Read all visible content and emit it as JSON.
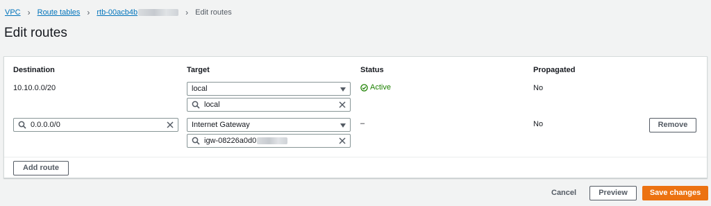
{
  "breadcrumb": {
    "items": [
      "VPC",
      "Route tables",
      "rtb-00acb4b"
    ],
    "current": "Edit routes"
  },
  "page_title": "Edit routes",
  "table": {
    "headers": [
      "Destination",
      "Target",
      "Status",
      "Propagated"
    ],
    "rows": [
      {
        "destination": "10.10.0.0/20",
        "target_type": "local",
        "target_value": "local",
        "status": "Active",
        "propagated": "No"
      },
      {
        "destination": "0.0.0.0/0",
        "target_type": "Internet Gateway",
        "target_value": "igw-08226a0d0",
        "status": "–",
        "propagated": "No",
        "remove_label": "Remove"
      }
    ],
    "add_route_label": "Add route"
  },
  "footer": {
    "cancel_label": "Cancel",
    "preview_label": "Preview",
    "save_label": "Save changes"
  },
  "colors": {
    "accent": "#ec7211",
    "link": "#0073bb",
    "success": "#1d8102"
  },
  "icons": [
    "chevron-right-icon",
    "search-icon",
    "clear-icon",
    "caret-down-icon",
    "check-circle-icon"
  ]
}
